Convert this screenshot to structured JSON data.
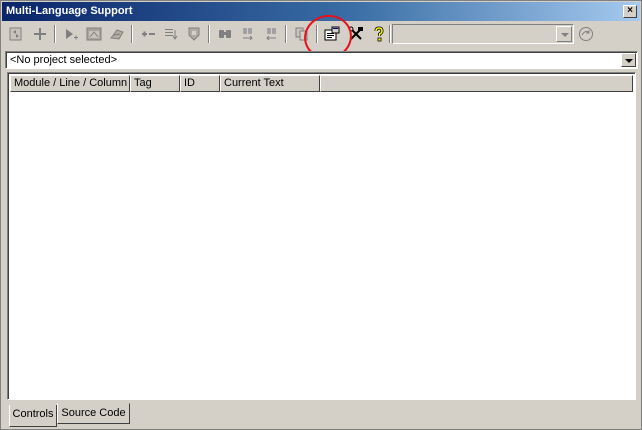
{
  "window": {
    "title": "Multi-Language Support",
    "close_glyph": "×"
  },
  "toolbar": {
    "buttons": [
      {
        "name": "refresh-icon"
      },
      {
        "name": "add-icon"
      },
      {
        "name": "run-scan-icon"
      },
      {
        "name": "form-icon"
      },
      {
        "name": "translate-icon"
      },
      {
        "name": "insert-row-icon"
      },
      {
        "name": "sort-list-icon"
      },
      {
        "name": "shield-icon"
      },
      {
        "name": "find-icon"
      },
      {
        "name": "find-next-icon"
      },
      {
        "name": "find-previous-icon"
      },
      {
        "name": "copy-icon"
      },
      {
        "name": "properties-icon"
      },
      {
        "name": "tools-icon"
      },
      {
        "name": "help-icon"
      },
      {
        "name": "go-icon"
      }
    ],
    "language_combo_value": ""
  },
  "project_selector": {
    "value": "<No project selected>"
  },
  "list": {
    "columns": [
      "Module / Line / Column",
      "Tag",
      "ID",
      "Current Text"
    ],
    "rows": []
  },
  "tabs": [
    {
      "label": "Controls",
      "active": true
    },
    {
      "label": "Source Code",
      "active": false
    }
  ],
  "colors": {
    "titlebar_start": "#0a246a",
    "titlebar_end": "#a6caf0",
    "annotation": "#e8101a",
    "face": "#d4d0c8"
  }
}
